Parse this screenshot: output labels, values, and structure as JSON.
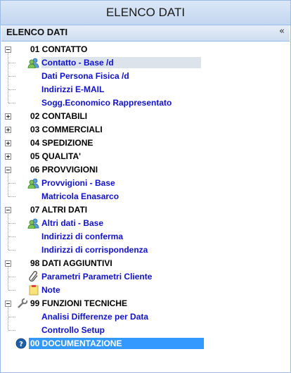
{
  "window": {
    "title": "ELENCO DATI"
  },
  "panel": {
    "title": "ELENCO DATI",
    "collapse_glyph": "«"
  },
  "tree": [
    {
      "label": "01 CONTATTO",
      "expanded": true,
      "children": [
        {
          "label": "Contatto - Base /d",
          "icon": "users-icon",
          "selected": true
        },
        {
          "label": "Dati Persona Fisica /d"
        },
        {
          "label": "Indirizzi E-MAIL"
        },
        {
          "label": "Sogg.Economico Rappresentato"
        }
      ]
    },
    {
      "label": "02 CONTABILI",
      "expanded": false
    },
    {
      "label": "03 COMMERCIALI",
      "expanded": false
    },
    {
      "label": "04 SPEDIZIONE",
      "expanded": false
    },
    {
      "label": "05 QUALITA'",
      "expanded": false
    },
    {
      "label": "06 PROVVIGIONI",
      "expanded": true,
      "children": [
        {
          "label": "Provvigioni - Base",
          "icon": "users-icon"
        },
        {
          "label": "Matricola Enasarco"
        }
      ]
    },
    {
      "label": "07 ALTRI DATI",
      "expanded": true,
      "children": [
        {
          "label": "Altri dati - Base",
          "icon": "users-icon"
        },
        {
          "label": "Indirizzi di conferma"
        },
        {
          "label": "Indirizzi di corrispondenza"
        }
      ]
    },
    {
      "label": "98 DATI AGGIUNTIVI",
      "expanded": true,
      "children": [
        {
          "label": "Parametri Parametri Cliente",
          "icon": "paperclip-icon"
        },
        {
          "label": "Note",
          "icon": "note-icon"
        }
      ]
    },
    {
      "label": "99 FUNZIONI TECNICHE",
      "expanded": true,
      "icon": "wrench-icon",
      "children": [
        {
          "label": "Analisi Differenze per Data"
        },
        {
          "label": "Controllo Setup"
        }
      ]
    },
    {
      "label": "00 DOCUMENTAZIONE",
      "icon": "help-icon",
      "highlighted": true
    }
  ],
  "colors": {
    "leaf_link": "#1111cc",
    "highlight": "#3399ff",
    "selected_row": "#dde3ea"
  }
}
